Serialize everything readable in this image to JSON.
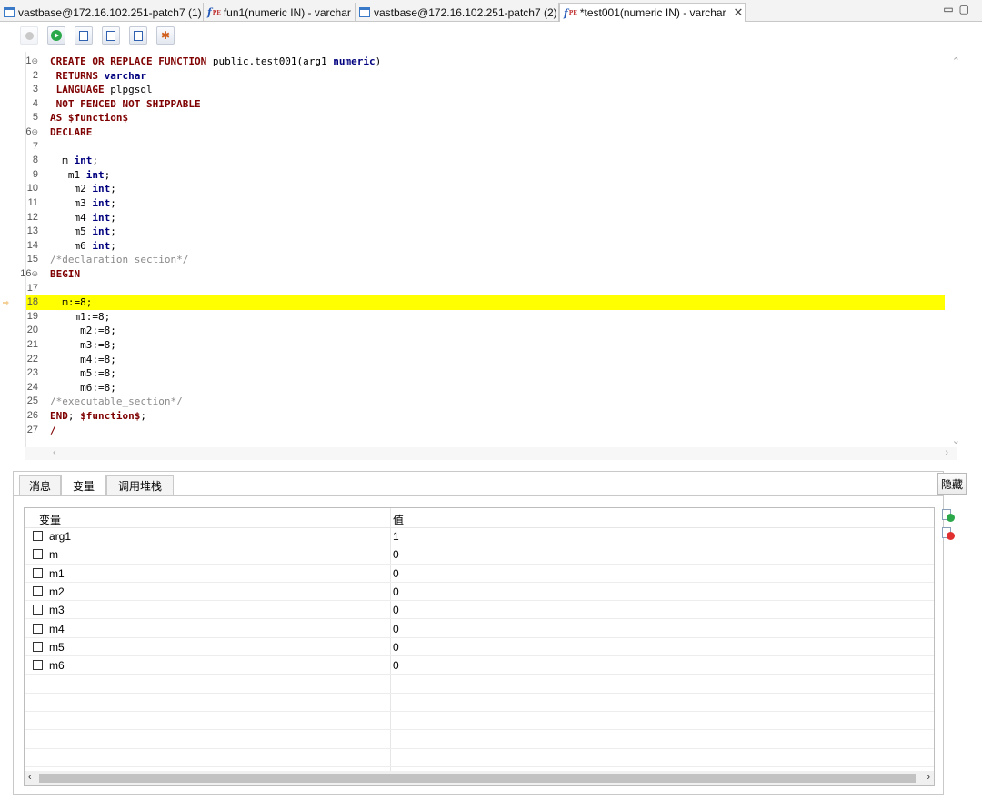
{
  "tabs": [
    {
      "label": "vastbase@172.16.102.251-patch7 (1)",
      "icon": "sql-window-icon"
    },
    {
      "label": "fun1(numeric IN) - varchar",
      "icon": "function-icon"
    },
    {
      "label": "vastbase@172.16.102.251-patch7 (2)",
      "icon": "sql-window-icon"
    },
    {
      "label": "*test001(numeric IN) - varchar",
      "icon": "function-icon",
      "active": true
    }
  ],
  "window_controls": {
    "minimize": "▭",
    "maximize": "▢"
  },
  "function_icon_text": {
    "f": "f",
    "sub": "PE"
  },
  "close_glyph": "✕",
  "editor": {
    "current_line": 18,
    "lines": [
      "CREATE OR REPLACE FUNCTION public.test001(arg1 numeric)",
      " RETURNS varchar",
      " LANGUAGE plpgsql",
      " NOT FENCED NOT SHIPPABLE",
      "AS $function$",
      "DECLARE",
      "",
      "  m int;",
      "   m1 int;",
      "    m2 int;",
      "    m3 int;",
      "    m4 int;",
      "    m5 int;",
      "    m6 int;",
      "/*declaration_section*/",
      "BEGIN",
      "",
      "  m:=8;",
      "    m1:=8;",
      "     m2:=8;",
      "     m3:=8;",
      "     m4:=8;",
      "     m5:=8;",
      "     m6:=8;",
      "/*executable_section*/",
      "END; $function$;",
      "/"
    ]
  },
  "panel": {
    "tabs": [
      "消息",
      "变量",
      "调用堆栈"
    ],
    "active_tab": "变量",
    "hide_label": "隐藏"
  },
  "variables": {
    "columns": [
      "变量",
      "值"
    ],
    "rows": [
      {
        "name": "arg1",
        "value": "1"
      },
      {
        "name": "m",
        "value": "0"
      },
      {
        "name": "m1",
        "value": "0"
      },
      {
        "name": "m2",
        "value": "0"
      },
      {
        "name": "m3",
        "value": "0"
      },
      {
        "name": "m4",
        "value": "0"
      },
      {
        "name": "m5",
        "value": "0"
      },
      {
        "name": "m6",
        "value": "0"
      }
    ]
  },
  "colors": {
    "highlight": "#ffff00",
    "keyword": "#7f0000",
    "type": "#00007f",
    "comment": "#8a8a8a"
  }
}
